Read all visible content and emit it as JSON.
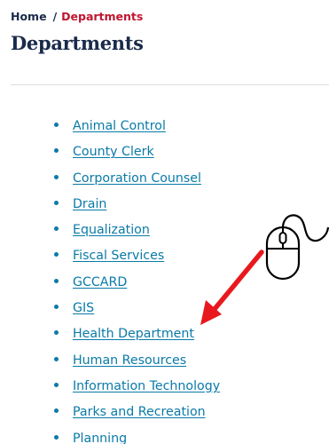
{
  "breadcrumb": {
    "home": "Home",
    "separator": "/",
    "current": "Departments"
  },
  "page_title": "Departments",
  "departments": [
    "Animal Control",
    "County Clerk",
    "Corporation Counsel",
    "Drain",
    "Equalization",
    "Fiscal Services",
    "GCCARD",
    "GIS",
    "Health Department",
    "Human Resources",
    "Information Technology",
    "Parks and Recreation",
    "Planning"
  ],
  "colors": {
    "heading": "#1a2a4a",
    "breadcrumb_current": "#c0152f",
    "link": "#0a7aa8",
    "arrow": "#e8191e"
  },
  "icons": {
    "mouse": "computer-mouse-icon",
    "arrow": "red-arrow-pointer"
  }
}
